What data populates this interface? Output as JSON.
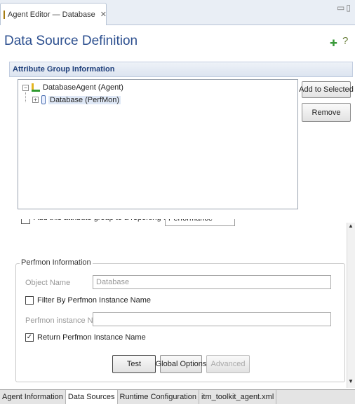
{
  "editor_tab": {
    "title": "Agent Editor — Database",
    "close": "✕"
  },
  "header": {
    "title": "Data Source Definition",
    "pin_icon": "➕",
    "help_icon": "?"
  },
  "section": {
    "title": "Attribute Group Information"
  },
  "tree": {
    "root": {
      "label": "DatabaseAgent (Agent)",
      "expander": "−"
    },
    "child": {
      "label": "Database (PerfMon)",
      "expander": "+"
    }
  },
  "buttons": {
    "add_to_selected": "Add to Selected",
    "remove": "Remove"
  },
  "perfmon": {
    "legend": "Perfmon Information",
    "object_name_label": "Object Name",
    "object_name_value": "Database",
    "filter_label": "Filter By Perfmon Instance Name",
    "instance_name_label": "Perfmon instance Name",
    "instance_name_value": "",
    "return_label": "Return Perfmon Instance Name",
    "return_checked": "✓"
  },
  "actions": {
    "test": "Test",
    "global_options": "Global Options",
    "advanced": "Advanced"
  },
  "bottom_tabs": [
    {
      "label": "Agent Information"
    },
    {
      "label": "Data Sources"
    },
    {
      "label": "Runtime Configuration"
    },
    {
      "label": "itm_toolkit_agent.xml"
    }
  ],
  "scroll": {
    "up": "▲",
    "down": "▼"
  }
}
